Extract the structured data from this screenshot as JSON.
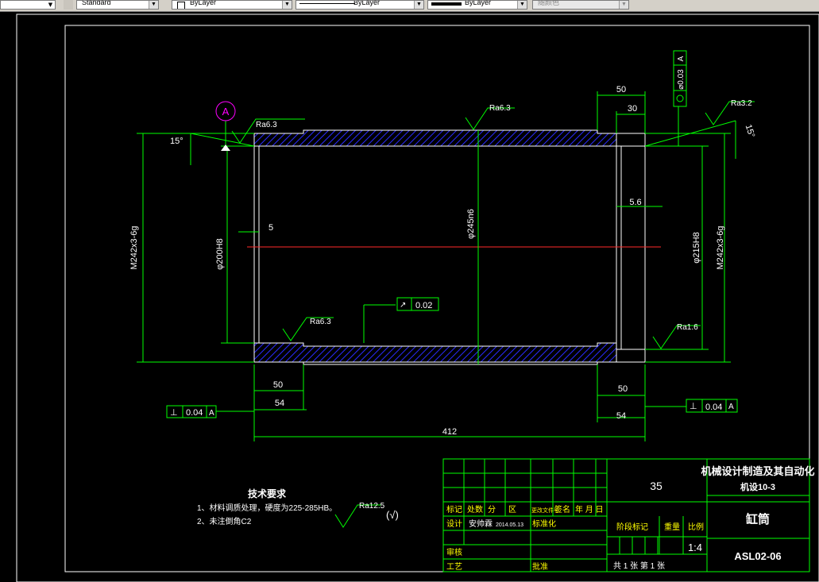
{
  "toolbar": {
    "text_style": "Standard",
    "layer": "ByLayer",
    "linetype": "ByLayer",
    "lineweight": "ByLayer",
    "plotstyle": "随颜色"
  },
  "dimensions": {
    "top_50": "50",
    "top_30": "30",
    "d_5_6": "5.6",
    "d_5": "5",
    "angle_left": "15°",
    "angle_right": "15°",
    "thread_left": "M242x3-6g",
    "thread_right": "M242x3-6g",
    "bore_left": "φ200H8",
    "bore_right": "φ215H8",
    "outer": "φ245n6",
    "bot_left_50": "50",
    "bot_left_54": "54",
    "bot_right_50": "50",
    "bot_right_54": "54",
    "overall": "412"
  },
  "roughness": {
    "r1": "Ra6.3",
    "r2": "Ra6.3",
    "r3": "Ra3.2",
    "r4": "Ra6.3",
    "r5": "Ra1.6",
    "general": "Ra12.5",
    "check": "(√)"
  },
  "tolerances": {
    "circularity_value": "⌀0.03",
    "circularity_datum": "A",
    "datum_label": "A",
    "runout_value": "0.02",
    "perp_left_value": "0.04",
    "perp_left_datum": "A",
    "perp_right_value": "0.04",
    "perp_right_datum": "A"
  },
  "notes": {
    "title": "技术要求",
    "line1": "1、材料调质处理，硬度为225-285HB。",
    "line2": "2、未注倒角C2"
  },
  "title_block": {
    "material": "35",
    "school_line1": "机械设计制造及其自动化",
    "school_line2": "机设10-3",
    "part_name": "缸筒",
    "drawing_no": "ASL02-06",
    "scale": "1:4",
    "h_mark": "标记",
    "h_count": "处数",
    "h_zone": "分",
    "h_area": "区",
    "h_doc": "更改文件号",
    "h_sign": "签名",
    "h_date": "年 月 日",
    "h_design": "设计",
    "designer": "安帅霖",
    "design_date": "2014.05.13",
    "h_std": "标准化",
    "h_stage": "阶段标记",
    "h_weight": "重量",
    "h_scale": "比例",
    "h_review": "审核",
    "h_process": "工艺",
    "h_approve": "批准",
    "sheets_text": "共  1  张   第  1  张"
  }
}
